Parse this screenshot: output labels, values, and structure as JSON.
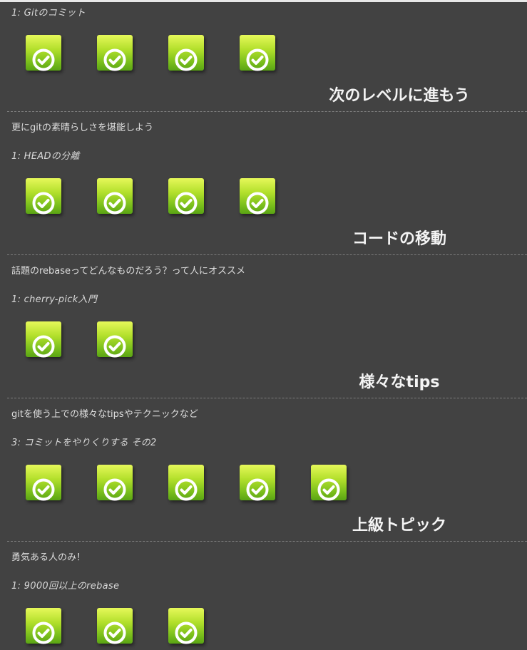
{
  "sections": [
    {
      "level_name": "1: Gitのコミット",
      "icon_count": 4
    },
    {
      "title": "次のレベルに進もう",
      "description": "更にgitの素晴らしさを堪能しよう",
      "level_name": "1: HEADの分離",
      "icon_count": 4
    },
    {
      "title": "コードの移動",
      "description": "話題のrebaseってどんなものだろう？って人にオススメ",
      "level_name": "1: cherry-pick入門",
      "icon_count": 2
    },
    {
      "title": "様々なtips",
      "description": "gitを使う上での様々なtipsやテクニックなど",
      "level_name": "3: コミットをやりくりする その2",
      "icon_count": 5
    },
    {
      "title": "上級トピック",
      "description": "勇気ある人のみ！",
      "level_name": "1: 9000回以上のrebase",
      "icon_count": 3
    }
  ],
  "icons": {
    "level_complete": "check-circle-icon"
  },
  "colors": {
    "background": "#424242",
    "icon_top": "#e6f85a",
    "icon_bottom": "#5aa414",
    "check": "#ffffff"
  }
}
